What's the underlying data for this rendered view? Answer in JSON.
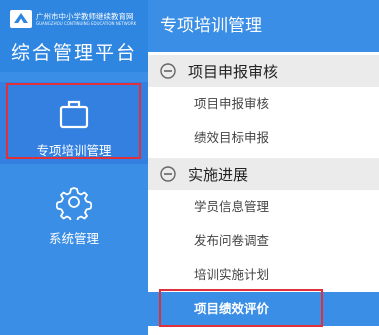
{
  "brand": {
    "logo_cn": "广州市中小学教师继续教育网",
    "logo_en": "GUANGZHOU CONTINUING EDUCATION NETWORK",
    "platform_title": "综合管理平台"
  },
  "rail": {
    "items": [
      {
        "label": "专项培训管理",
        "icon": "briefcase-icon",
        "active": true
      },
      {
        "label": "系统管理",
        "icon": "gear-icon",
        "active": false
      }
    ]
  },
  "panel": {
    "title": "专项培训管理",
    "groups": [
      {
        "label": "项目申报审核",
        "icon": "minus-circle-icon",
        "items": [
          {
            "label": "项目申报审核"
          },
          {
            "label": "绩效目标申报"
          }
        ]
      },
      {
        "label": "实施进展",
        "icon": "minus-circle-icon",
        "items": [
          {
            "label": "学员信息管理"
          },
          {
            "label": "发布问卷调查"
          },
          {
            "label": "培训实施计划"
          },
          {
            "label": "项目绩效评价",
            "selected": true
          }
        ]
      }
    ]
  },
  "colors": {
    "primary": "#3a8ee6",
    "highlight_border": "#e0303a",
    "group_bg": "#ebebeb"
  }
}
